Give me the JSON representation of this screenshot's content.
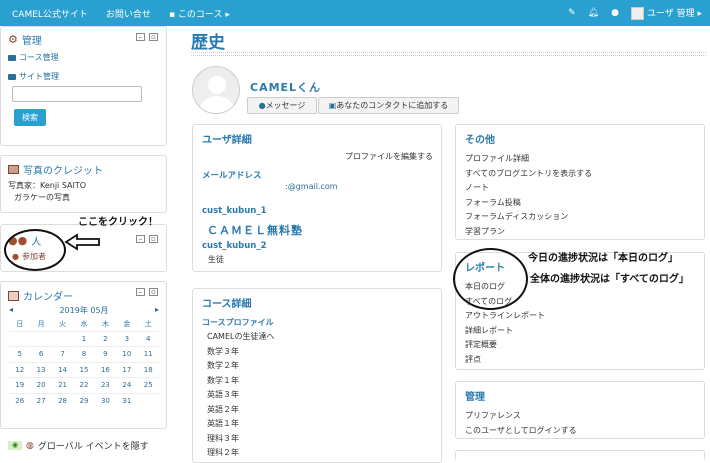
{
  "navbar": {
    "site_link": "CAMEL公式サイト",
    "contact_link": "お問い合せ",
    "this_course": "このコース ▸",
    "user_menu": "ユーザ 管理 ▸"
  },
  "admin_block": {
    "title": "管理",
    "items": [
      "コース管理",
      "サイト管理"
    ],
    "search_button": "検索",
    "search_value": ""
  },
  "credit_block": {
    "title": "写真のクレジット",
    "lines": [
      "写真家：Kenji SAITO",
      "ガラケーの写真"
    ]
  },
  "people_block": {
    "title": "人",
    "item": "参加者"
  },
  "calendar": {
    "title": "カレンダー",
    "month": "2019年 05月",
    "weekdays": [
      "日",
      "月",
      "火",
      "水",
      "木",
      "金",
      "土"
    ],
    "weeks": [
      [
        "",
        "",
        "",
        "1",
        "2",
        "3",
        "4"
      ],
      [
        "5",
        "6",
        "7",
        "8",
        "9",
        "10",
        "11"
      ],
      [
        "12",
        "13",
        "14",
        "15",
        "16",
        "17",
        "18"
      ],
      [
        "19",
        "20",
        "21",
        "22",
        "23",
        "24",
        "25"
      ],
      [
        "26",
        "27",
        "28",
        "29",
        "30",
        "31",
        ""
      ]
    ]
  },
  "global_events": "グローバル イベントを隠す",
  "page_title": "歴史",
  "profile": {
    "name": "CAMELくん",
    "message_button": "メッセージ",
    "contact_button": "あなたのコンタクトに追加する"
  },
  "user_details": {
    "title": "ユーザ詳細",
    "edit_link": "プロファイルを編集する",
    "email_label": "メールアドレス",
    "email_value": ":@gmail.com",
    "field1": "cust_kubun_1",
    "org": "ＣＡＭＥＬ無料塾",
    "field2": "cust_kubun_2",
    "role": "生徒"
  },
  "course_details": {
    "title": "コース詳細",
    "label": "コースプロファイル",
    "courses": [
      "CAMELの生徒達へ",
      "数学３年",
      "数学２年",
      "数学１年",
      "英語３年",
      "英語２年",
      "英語１年",
      "理科３年",
      "理科２年"
    ]
  },
  "other": {
    "title": "その他",
    "items": [
      "プロファイル詳細",
      "すべてのブログエントリを表示する",
      "ノート",
      "フォーラム投稿",
      "フォーラムディスカッション",
      "学習プラン"
    ]
  },
  "reports": {
    "title": "レポート",
    "items": [
      "本日のログ",
      "すべてのログ",
      "アウトラインレポート",
      "詳細レポート",
      "評定概要",
      "評点"
    ]
  },
  "manage": {
    "title": "管理",
    "items": [
      "プリファレンス",
      "このユーザとしてログインする"
    ]
  },
  "annotations": {
    "click_here": "ここをクリック！",
    "today_log": "今日の進捗状況は「本日のログ」",
    "all_log": "全体の進捗状況は「すべてのログ」"
  },
  "colors": {
    "navbar": "#29a0cf",
    "link": "#2a6f95",
    "heading": "#2a7ab0"
  }
}
